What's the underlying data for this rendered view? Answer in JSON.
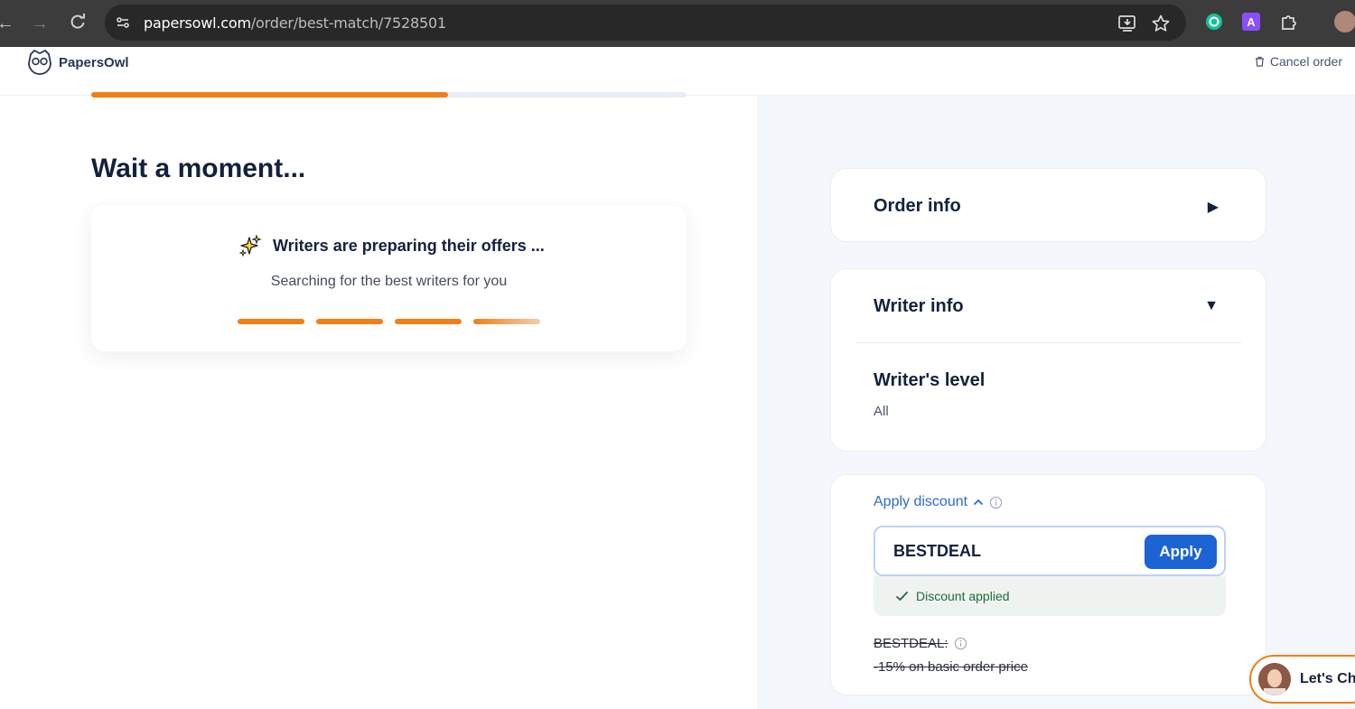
{
  "browser": {
    "url_host": "papersowl.com",
    "url_path": "/order/best-match/7528501"
  },
  "header": {
    "brand": "PapersOwl",
    "cancel_label": "Cancel order"
  },
  "progress": {
    "fraction": 0.6
  },
  "main": {
    "title": "Wait a moment...",
    "card_title": "Writers are preparing their offers ...",
    "card_subtitle": "Searching for the best writers for you"
  },
  "sidebar": {
    "order_info": {
      "title": "Order info",
      "state": "collapsed"
    },
    "writer_info": {
      "title": "Writer info",
      "state": "expanded",
      "level_label": "Writer's level",
      "level_value": "All"
    },
    "discount": {
      "toggle_label": "Apply discount",
      "code_value": "BESTDEAL",
      "apply_label": "Apply",
      "status": "Discount applied",
      "promo_name": "BESTDEAL:",
      "promo_desc": "-15% on basic order price"
    }
  },
  "chat": {
    "label": "Let's Chat"
  },
  "colors": {
    "accent_orange": "#f07f17",
    "primary_blue": "#1c64d4",
    "success_green": "#1d6b3c"
  }
}
